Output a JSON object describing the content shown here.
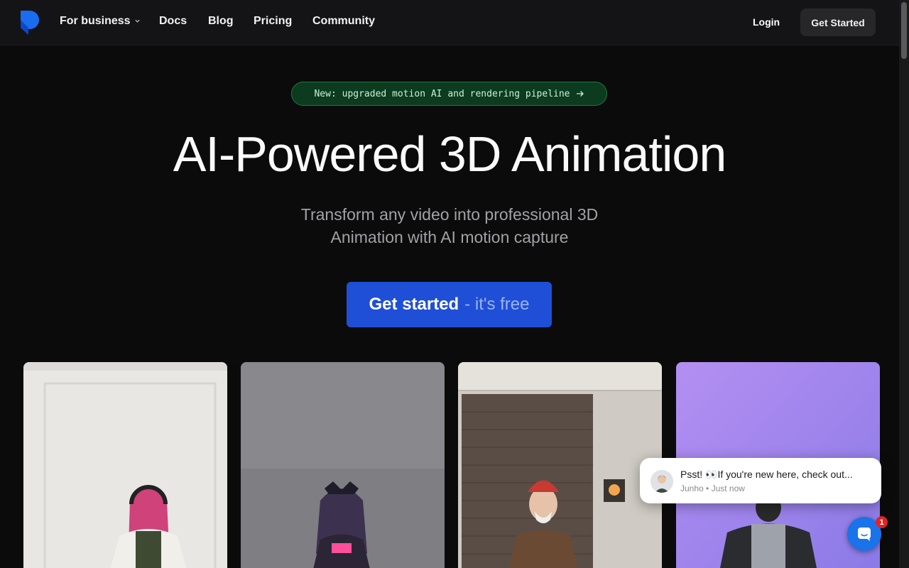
{
  "nav": {
    "links": [
      {
        "label": "For business"
      },
      {
        "label": "Docs"
      },
      {
        "label": "Blog"
      },
      {
        "label": "Pricing"
      },
      {
        "label": "Community"
      }
    ],
    "login": "Login",
    "cta": "Get Started"
  },
  "hero": {
    "announcement": "New: upgraded motion AI and rendering pipeline",
    "title": "AI-Powered 3D Animation",
    "subtitle": "Transform any video into professional 3D Animation with AI motion capture",
    "cta_main": "Get started",
    "cta_suffix": "- it's free"
  },
  "chat": {
    "message": "Psst! 👀If you're new here, check out...",
    "author_line": "Junho • Just now",
    "badge": "1"
  },
  "colors": {
    "accent": "#1f4fd6",
    "announce_bg": "#0d3b1f",
    "chat_launcher": "#1a73e8"
  }
}
